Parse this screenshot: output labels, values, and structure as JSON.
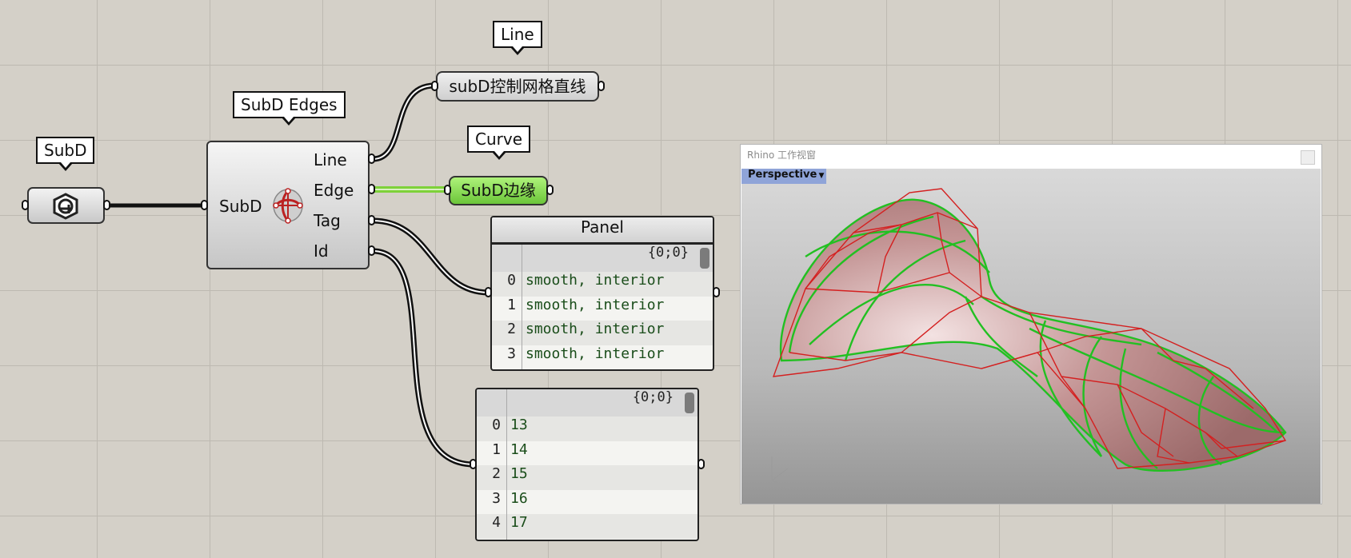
{
  "canvas": {
    "tags": {
      "subd": "SubD",
      "subd_edges": "SubD Edges",
      "line": "Line",
      "curve": "Curve"
    },
    "subd_edges_component": {
      "input": "SubD",
      "outputs": [
        "Line",
        "Edge",
        "Tag",
        "Id"
      ]
    },
    "line_param_label": "subD控制网格直线",
    "edge_param_label": "SubD边缘",
    "tag_panel": {
      "title": "Panel",
      "path": "{0;0}",
      "rows": [
        {
          "index": "0",
          "value": "smooth, interior"
        },
        {
          "index": "1",
          "value": "smooth, interior"
        },
        {
          "index": "2",
          "value": "smooth, interior"
        },
        {
          "index": "3",
          "value": "smooth, interior"
        }
      ]
    },
    "id_panel": {
      "path": "{0;0}",
      "rows": [
        {
          "index": "0",
          "value": "13"
        },
        {
          "index": "1",
          "value": "14"
        },
        {
          "index": "2",
          "value": "15"
        },
        {
          "index": "3",
          "value": "16"
        },
        {
          "index": "4",
          "value": "17"
        }
      ]
    }
  },
  "viewport": {
    "window_title": "Rhino 工作视窗",
    "view_name": "Perspective",
    "colors": {
      "mesh_cage": "#d42020",
      "subd_edges": "#22c022",
      "surface": "#b98585",
      "edge_preview": "#7ed13a"
    }
  }
}
